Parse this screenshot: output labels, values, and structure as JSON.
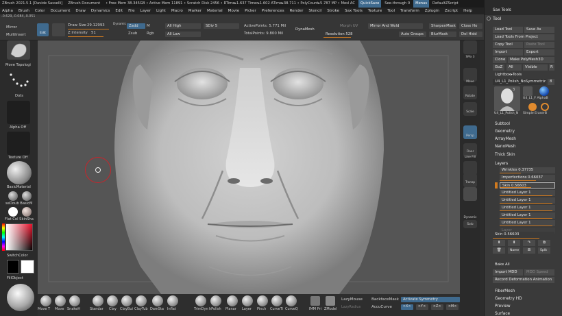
{
  "titlebar": {
    "app": "ZBrush 2021.5.1 [Davide Sasselli]",
    "doc": "ZBrush Document",
    "stats": "• Free Mem 38.345GB • Active Mem 11891 • Scratch Disk 2456 • RTime▸1.637 Timer▸1.602 ATime▸38.711 • PolyCount▸5.787 MP • Mesl AC",
    "quicksave": "QuickSave",
    "seethrough": "See-through  0",
    "menus": "Menus",
    "script": "DefaultZScript"
  },
  "menubar": [
    "Alpha",
    "Brush",
    "Color",
    "Document",
    "Draw",
    "Dynamics",
    "Edit",
    "File",
    "Layer",
    "Light",
    "Macro",
    "Marker",
    "Material",
    "Movie",
    "Picker",
    "Preferences",
    "Render",
    "Stencil",
    "Stroke",
    "Sax Tools",
    "Texture",
    "Tool",
    "Transform",
    "Zplugin",
    "Zscript",
    "Help"
  ],
  "coords": "-0.629,-0.084,-0.051",
  "toolbar": {
    "mirror": "Mirror",
    "multiinsert": "MultiInsert",
    "edit": "Edit",
    "draw_size_label": "Draw Size",
    "draw_size": "29.12993",
    "dynamic": "Dynamic",
    "z_intensity_label": "Z Intensity",
    "z_intensity": "51",
    "zadd": "Zadd",
    "zsub": "Zsub",
    "m": "M",
    "rgb": "Rgb",
    "all_high": "All High",
    "all_low": "All Low",
    "sdiv_label": "SDiv",
    "sdiv": "5",
    "active_points": "ActivePoints: 5.771 Mil",
    "total_points": "TotalPoints: 9.800 Mil",
    "dynamesh": "DynaMesh",
    "morph_uv": "Morph UV",
    "resolution_label": "Resolution",
    "resolution": "528",
    "mirror_weld": "Mirror And Weld",
    "auto_groups": "Auto Groups",
    "sharpen_mask": "SharpenMask",
    "blur_mask": "BlurMask",
    "close_holes": "Close Ho",
    "del_hidden": "Del Hidd"
  },
  "leftshelf": {
    "move_topo": "Move Topologi",
    "dots": "Dots",
    "alpha_off": "Alpha Off",
    "texture_off": "Texture Off",
    "basic_material": "BasicMaterial",
    "sedouble": "seDoub BasicM",
    "flatcolor": "Flat Col SkinSha",
    "switch_color": "SwitchColor",
    "fill_object": "FillObject"
  },
  "bottom_brushes": [
    "Move T",
    "Move",
    "SnakeH",
    "Standar",
    "Clay",
    "ClayBui",
    "ClayTub",
    "DamSta",
    "Inflat",
    "TrimDyn",
    "hPolish",
    "Planar",
    "Layer",
    "Pinch",
    "CurveTi",
    "CurveQ",
    "IMM Pri",
    "ZModel"
  ],
  "bottom_extra": {
    "lazymouse": "LazyMouse",
    "lazyradius": "LazyRadius",
    "backface": "BackfaceMask",
    "accucurve": "AccuCurve",
    "activate_symmetry": "Activate Symmetry",
    "sym_x": ">X<",
    "sym_y": ">Y<",
    ">Z<": ">Z<",
    "sym_m": ">M<"
  },
  "rightshelf": [
    "SPix 3",
    "Move",
    "Rotate",
    "Scale",
    "Persp",
    "Floor",
    "Line Fill",
    "Transp",
    "Dynamic",
    "Solo"
  ],
  "panel": {
    "header_top": "Sax Tools",
    "tool_header": "Tool",
    "load_tool": "Load Tool",
    "save_as": "Save As",
    "load_from_project": "Load Tools From Project",
    "copy_tool": "Copy Tool",
    "paste_tool": "Paste Tool",
    "import": "Import",
    "export": "Export",
    "clone": "Clone",
    "make_polymesh": "Make PolyMesh3D",
    "goz": "GoZ",
    "all": "All",
    "visible": "Visible",
    "visible_r": "R",
    "lightbox_tools": "Lightbox▸Tools",
    "tool_name": "U4_L1_Polish_NoSymmetriz",
    "tool_count": "8",
    "thumb_label_1": "U4_L1_Polish_N",
    "thumb_label_2": "U4_L1_F AlphaB",
    "thumb_label_3": "Simple EraserB",
    "thumb_num": "3",
    "sections": [
      "Subtool",
      "Geometry",
      "ArrayMesh",
      "NanoMesh",
      "Thick Skin",
      "Layers"
    ],
    "layers": [
      {
        "name": "Wrinkles",
        "value": "0.37735",
        "fill": 0.38
      },
      {
        "name": "Imperfections",
        "value": "0.66037",
        "fill": 0.66
      },
      {
        "name": "Skin",
        "value": "0.56603",
        "fill": 0.57
      },
      {
        "name": "Untitled Layer 1",
        "value": "",
        "fill": 0.95
      },
      {
        "name": "Untitled Layer 1",
        "value": "",
        "fill": 0.95
      },
      {
        "name": "Untitled Layer 1",
        "value": "",
        "fill": 0.95
      },
      {
        "name": "Untitled Layer 1",
        "value": "",
        "fill": 0.95
      },
      {
        "name": "Untitled Layer 1",
        "value": "",
        "fill": 0.95
      },
      {
        "name": "Layer",
        "value": "",
        "fill": 0
      }
    ],
    "skin_field": "Skin 0.56603",
    "name_btn": "Name",
    "split_btn": "Split",
    "bake_all": "Bake All",
    "import_mdd": "Import MDD",
    "mdd_speed": "MDD Speed",
    "record_anim": "Record Deformation Animation",
    "fibermesh": "FiberMesh",
    "geometry_hd": "Geometry HD",
    "preview": "Preview",
    "surface": "Surface"
  },
  "colors": {
    "accent": "#d07a1f",
    "blue": "#3f6a8e",
    "bg": "#2c2c2c",
    "panel": "#3a3a3a"
  }
}
